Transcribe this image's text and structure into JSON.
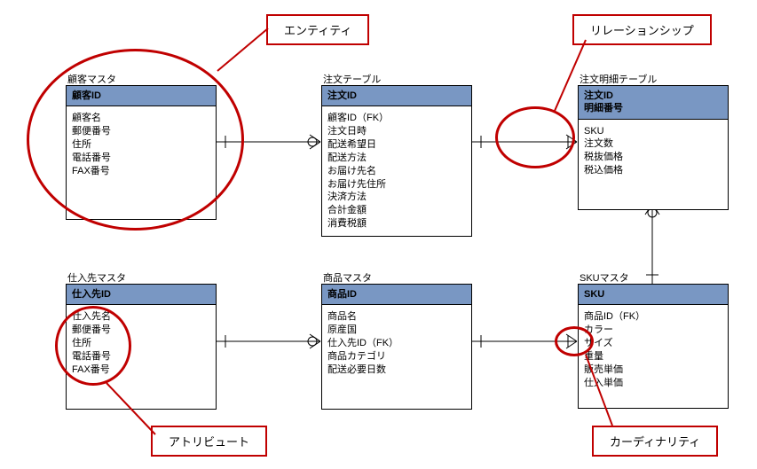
{
  "labels": {
    "entity": "エンティティ",
    "relationship": "リレーションシップ",
    "attribute": "アトリビュート",
    "cardinality": "カーディナリティ"
  },
  "entities": {
    "customer": {
      "title": "顧客マスタ",
      "pk": [
        "顧客ID"
      ],
      "attrs": [
        "顧客名",
        "郵便番号",
        "住所",
        "電話番号",
        "FAX番号"
      ]
    },
    "order": {
      "title": "注文テーブル",
      "pk": [
        "注文ID"
      ],
      "attrs": [
        "顧客ID（FK）",
        "注文日時",
        "配送希望日",
        "配送方法",
        "お届け先名",
        "お届け先住所",
        "決済方法",
        "合計金額",
        "消費税額"
      ]
    },
    "orderDetail": {
      "title": "注文明細テーブル",
      "pk": [
        "注文ID",
        "明細番号"
      ],
      "attrs": [
        "SKU",
        "注文数",
        "税抜価格",
        "税込価格"
      ]
    },
    "supplier": {
      "title": "仕入先マスタ",
      "pk": [
        "仕入先ID"
      ],
      "attrs": [
        "仕入先名",
        "郵便番号",
        "住所",
        "電話番号",
        "FAX番号"
      ]
    },
    "product": {
      "title": "商品マスタ",
      "pk": [
        "商品ID"
      ],
      "attrs": [
        "商品名",
        "原産国",
        "仕入先ID（FK）",
        "商品カテゴリ",
        "配送必要日数"
      ]
    },
    "sku": {
      "title": "SKUマスタ",
      "pk": [
        "SKU"
      ],
      "attrs": [
        "商品ID（FK）",
        "カラー",
        "サイズ",
        "重量",
        "販売単価",
        "仕入単価"
      ]
    }
  },
  "relationships": [
    {
      "from": "customer",
      "to": "order",
      "type": "one-to-many"
    },
    {
      "from": "order",
      "to": "orderDetail",
      "type": "one-to-many"
    },
    {
      "from": "supplier",
      "to": "product",
      "type": "one-to-many"
    },
    {
      "from": "product",
      "to": "sku",
      "type": "one-to-many"
    },
    {
      "from": "sku",
      "to": "orderDetail",
      "type": "one-to-many"
    }
  ],
  "annotations": [
    {
      "target": "customer-entity",
      "label": "エンティティ"
    },
    {
      "target": "order-orderDetail-relationship",
      "label": "リレーションシップ"
    },
    {
      "target": "supplier-attributes",
      "label": "アトリビュート"
    },
    {
      "target": "product-sku-crowfoot",
      "label": "カーディナリティ"
    }
  ]
}
